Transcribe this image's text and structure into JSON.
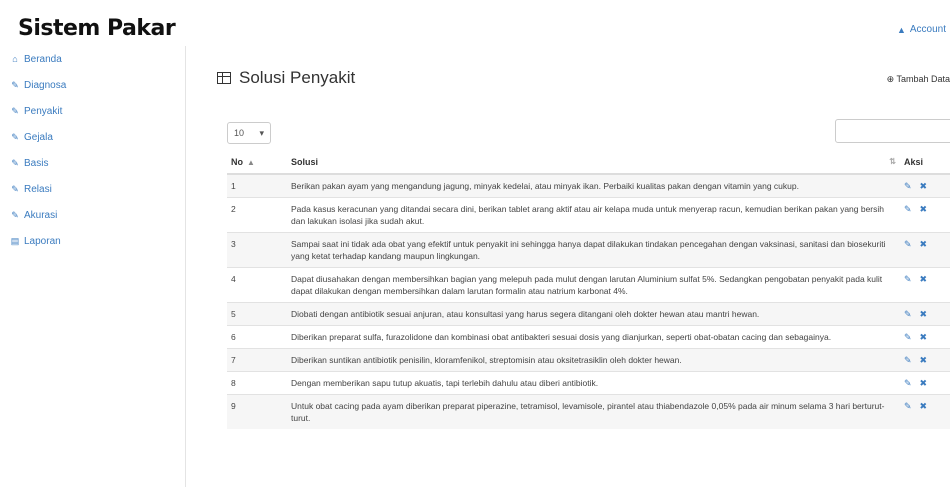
{
  "app": {
    "title": "Sistem Pakar",
    "account_label": "Account"
  },
  "sidebar": {
    "items": [
      {
        "icon": "home-icon",
        "glyph": "⌂",
        "label": "Beranda"
      },
      {
        "icon": "diagnosa-icon",
        "glyph": "✎",
        "label": "Diagnosa"
      },
      {
        "icon": "penyakit-icon",
        "glyph": "✎",
        "label": "Penyakit"
      },
      {
        "icon": "gejala-icon",
        "glyph": "✎",
        "label": "Gejala"
      },
      {
        "icon": "basis-icon",
        "glyph": "✎",
        "label": "Basis"
      },
      {
        "icon": "relasi-icon",
        "glyph": "✎",
        "label": "Relasi"
      },
      {
        "icon": "akurasi-icon",
        "glyph": "✎",
        "label": "Akurasi"
      },
      {
        "icon": "laporan-icon",
        "glyph": "▤",
        "label": "Laporan"
      }
    ]
  },
  "main": {
    "title": "Solusi Penyakit",
    "add_label": "Tambah Data",
    "length_value": "10",
    "search_placeholder": "",
    "columns": {
      "no": "No",
      "solusi": "Solusi",
      "aksi": "Aksi"
    },
    "rows": [
      {
        "no": "1",
        "solusi": "Berikan pakan ayam yang mengandung jagung, minyak kedelai, atau minyak ikan. Perbaiki kualitas pakan dengan vitamin yang cukup."
      },
      {
        "no": "2",
        "solusi": "Pada kasus keracunan yang ditandai secara dini, berikan tablet arang aktif atau air kelapa muda untuk menyerap racun, kemudian berikan pakan yang bersih dan lakukan isolasi jika sudah akut."
      },
      {
        "no": "3",
        "solusi": "Sampai saat ini tidak ada obat yang efektif untuk penyakit ini sehingga hanya dapat dilakukan tindakan pencegahan dengan vaksinasi, sanitasi dan biosekuriti yang ketat terhadap kandang maupun lingkungan."
      },
      {
        "no": "4",
        "solusi": "Dapat diusahakan dengan membersihkan bagian yang melepuh pada mulut dengan larutan Aluminium sulfat 5%. Sedangkan pengobatan penyakit pada kulit dapat dilakukan dengan membersihkan dalam larutan formalin atau natrium karbonat 4%."
      },
      {
        "no": "5",
        "solusi": "Diobati dengan antibiotik sesuai anjuran, atau konsultasi yang harus segera ditangani oleh dokter hewan atau mantri hewan."
      },
      {
        "no": "6",
        "solusi": "Diberikan preparat sulfa, furazolidone dan kombinasi obat antibakteri sesuai dosis yang dianjurkan, seperti obat-obatan cacing dan sebagainya."
      },
      {
        "no": "7",
        "solusi": "Diberikan suntikan antibiotik penisilin, kloramfenikol, streptomisin atau oksitetrasiklin oleh dokter hewan."
      },
      {
        "no": "8",
        "solusi": "Dengan memberikan sapu tutup akuatis, tapi terlebih dahulu atau diberi antibiotik."
      },
      {
        "no": "9",
        "solusi": "Untuk obat cacing pada ayam diberikan preparat piperazine, tetramisol, levamisole, pirantel atau thiabendazole 0,05% pada air minum selama 3 hari berturut-turut."
      }
    ]
  }
}
